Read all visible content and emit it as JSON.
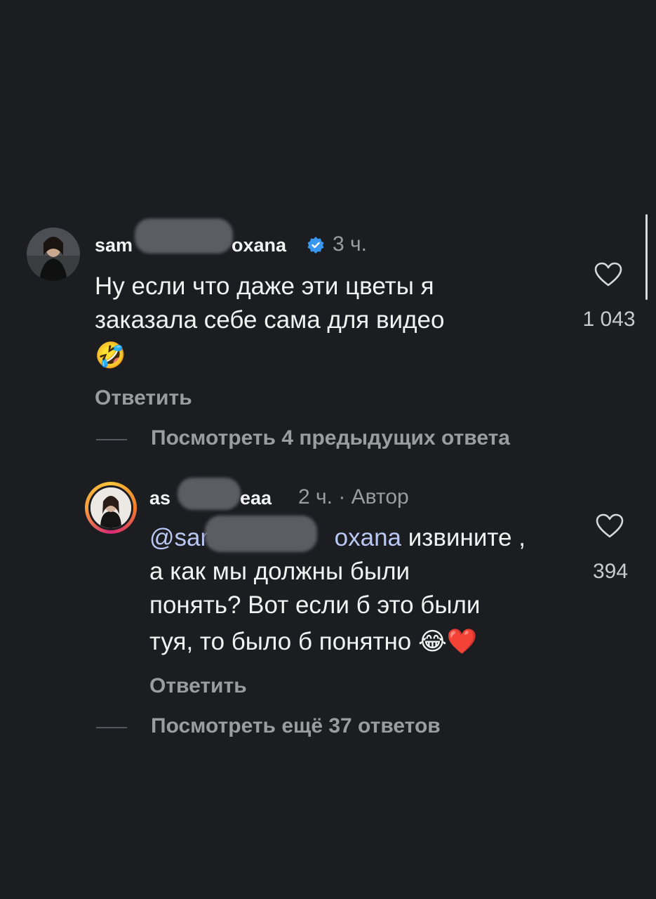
{
  "comment": {
    "username_start": "sam",
    "username_end": "oxana",
    "time": "3 ч.",
    "text_line1": "Ну если что даже эти цветы я",
    "text_line2": "заказала себе сама для видео",
    "emoji": "🤣",
    "reply_label": "Ответить",
    "like_count": "1 043",
    "view_replies": "Посмотреть 4 предыдущих ответа"
  },
  "reply": {
    "username_start": "as",
    "username_end": "eaa",
    "time": "2 ч. · Автор",
    "mention_start": "@sam",
    "mention_end": "oxana",
    "text_line1_rest": " извините ,",
    "text_line2": "а как мы должны были",
    "text_line3": "понять? Вот если б это были",
    "text_line4": "туя, то было б понятно ",
    "emoji": "😂❤️",
    "reply_label": "Ответить",
    "like_count": "394",
    "view_more": "Посмотреть ещё 37 ответов"
  },
  "colors": {
    "background": "#1b1d21",
    "verified": "#3897f0",
    "mention": "#b9c7f3",
    "muted": "#9a9ca0"
  },
  "icons": [
    "verified-badge-icon",
    "heart-icon"
  ]
}
